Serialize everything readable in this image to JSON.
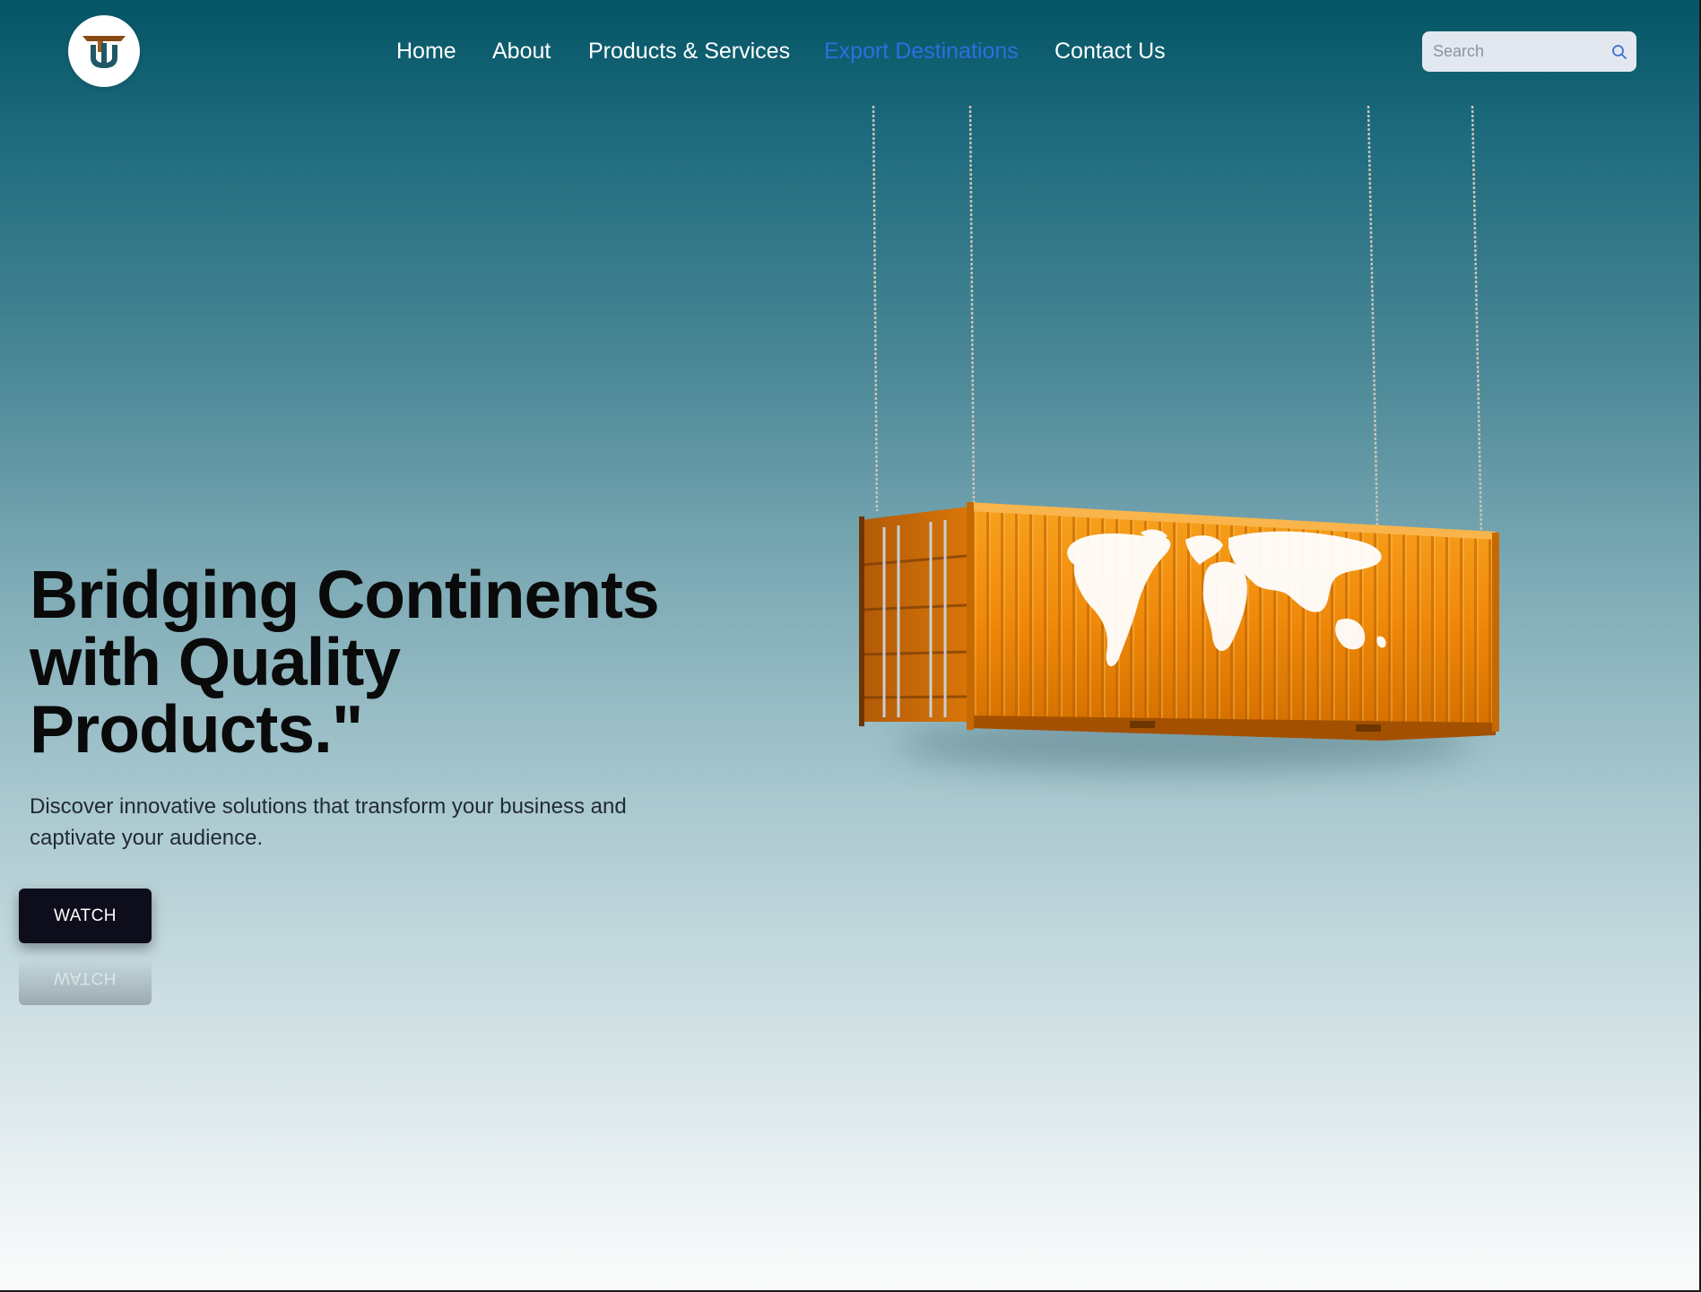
{
  "header": {
    "logo_icon": "tu-monogram-logo-icon",
    "nav": [
      {
        "label": "Home",
        "active": false
      },
      {
        "label": "About",
        "active": false
      },
      {
        "label": "Products & Services",
        "active": false
      },
      {
        "label": "Export Destinations",
        "active": true
      },
      {
        "label": "Contact Us",
        "active": false
      }
    ],
    "search": {
      "placeholder": "Search",
      "value": "",
      "icon": "search-icon"
    }
  },
  "hero": {
    "title": "Bridging Continents with Quality Products.\"",
    "subtitle": "Discover innovative solutions that transform your business and captivate your audience.",
    "watch_label": "WATCH",
    "image": "hanging-shipping-container-world-map"
  },
  "colors": {
    "gradient_top": "#045565",
    "gradient_bottom": "#fafbfb",
    "nav_text": "#ffffff",
    "nav_active": "#2f6ee0",
    "button_bg": "#0e0d1c",
    "container_orange": "#f08a0a",
    "logo_brown": "#8a4a16",
    "logo_teal": "#1f5866"
  }
}
